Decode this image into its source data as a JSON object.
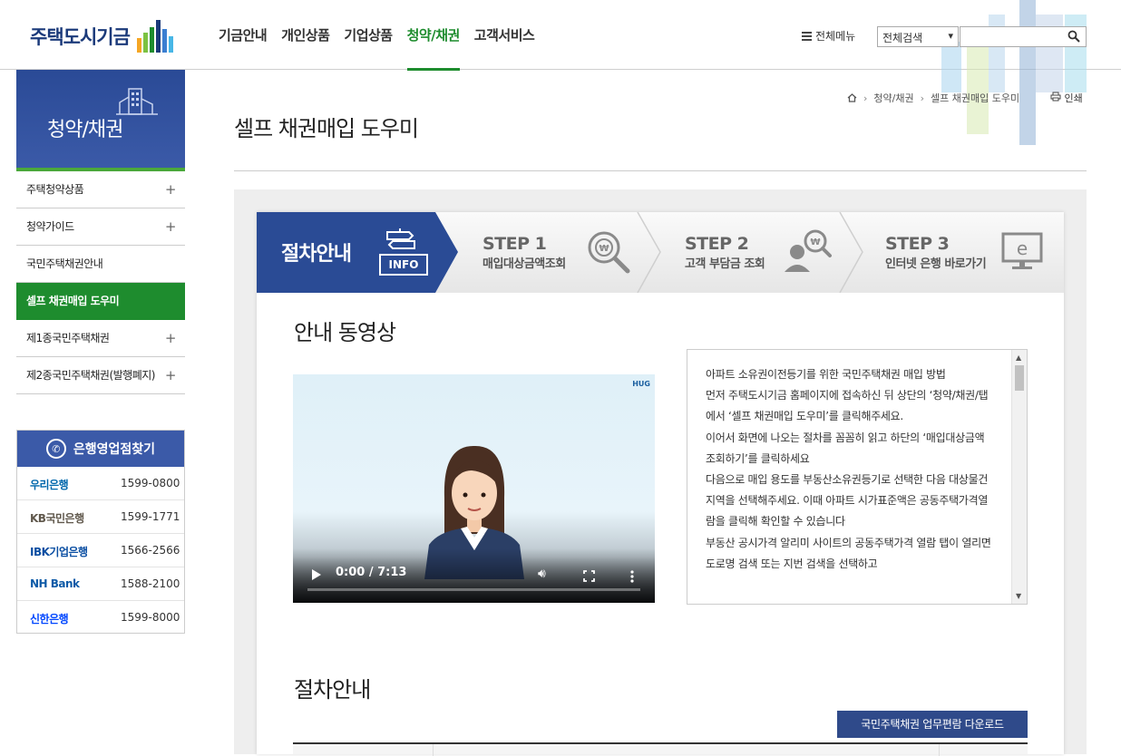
{
  "header": {
    "logo_text": "주택도시기금",
    "nav": [
      "기금안내",
      "개인상품",
      "기업상품",
      "청약/채권",
      "고객서비스"
    ],
    "nav_active_index": 3,
    "all_menu": "전체메뉴",
    "search_scope": "전체검색",
    "search_value": ""
  },
  "colors": {
    "primary": "#2a4b95",
    "accent_green": "#1e8c2e"
  },
  "sidebar": {
    "title": "청약/채권",
    "items": [
      {
        "label": "주택청약상품",
        "has_children": true
      },
      {
        "label": "청약가이드",
        "has_children": true
      },
      {
        "label": "국민주택채권안내",
        "has_children": false
      },
      {
        "label": "셀프 채권매입 도우미",
        "has_children": false,
        "active": true
      },
      {
        "label": "제1종국민주택채권",
        "has_children": true
      },
      {
        "label": "제2종국민주택채권(발행폐지)",
        "has_children": true
      }
    ],
    "plus": "+"
  },
  "banks": {
    "title": "은행영업점찾기",
    "list": [
      {
        "name": "우리은행",
        "phone": "1599-0800",
        "color": "#0067ac"
      },
      {
        "name": "KB국민은행",
        "phone": "1599-1771",
        "color": "#60584c"
      },
      {
        "name": "IBK기업은행",
        "phone": "1566-2566",
        "color": "#0a4ea2"
      },
      {
        "name": "NH Bank",
        "phone": "1588-2100",
        "color": "#0d5aa7"
      },
      {
        "name": "신한은행",
        "phone": "1599-8000",
        "color": "#0046ff"
      }
    ]
  },
  "breadcrumb": {
    "items": [
      "청약/채권",
      "셀프 채권매입 도우미"
    ],
    "print": "인쇄"
  },
  "page_title": "셀프 채권매입 도우미",
  "steps": {
    "intro": {
      "label": "절차안내",
      "badge": "INFO"
    },
    "list": [
      {
        "step": "STEP 1",
        "desc": "매입대상금액조회"
      },
      {
        "step": "STEP 2",
        "desc": "고객 부담금 조회"
      },
      {
        "step": "STEP 3",
        "desc": "인터넷 은행 바로가기"
      }
    ]
  },
  "video_section": {
    "title": "안내 동영상",
    "video": {
      "brand": "HUG",
      "time": "0:00 / 7:13",
      "progress": 0
    },
    "description": [
      "아파트 소유권이전등기를 위한 국민주택채권 매입 방법",
      "먼저 주택도시기금 홈페이지에 접속하신 뒤 상단의 ‘청약/채권/탭에서 ‘셀프 채권매입 도우미’를 클릭해주세요.",
      "이어서 화면에 나오는 절차를 꼼꼼히 읽고 하단의 ‘매입대상금액 조회하기’를 클릭하세요",
      "다음으로 매입 용도를 부동산소유권등기로 선택한 다음 대상물건지역을 선택해주세요. 이때 아파트 시가표준액은 공동주택가격열람을 클릭해 확인할 수 있습니다",
      "부동산 공시가격 알리미 사이트의 공동주택가격 열람 탭이 열리면 도로명 검색 또는 지번 검색을 선택하고"
    ]
  },
  "procedure_section": {
    "title": "절차안내",
    "download_button": "국민주택채권 업무편람 다운로드"
  }
}
